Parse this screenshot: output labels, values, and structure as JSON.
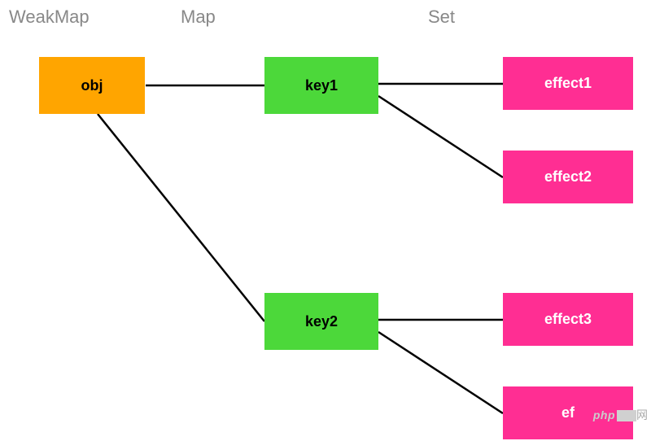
{
  "headers": {
    "weakmap": "WeakMap",
    "map": "Map",
    "set": "Set"
  },
  "nodes": {
    "obj": "obj",
    "key1": "key1",
    "key2": "key2",
    "effect1": "effect1",
    "effect2": "effect2",
    "effect3": "effect3",
    "effect4": "ef"
  },
  "watermark": {
    "brand": "php",
    "suffix": "网"
  },
  "chart_data": {
    "type": "diagram",
    "title": "Reactive effect tracking structure",
    "structure": {
      "WeakMap": {
        "obj": {
          "type": "Map",
          "entries": {
            "key1": {
              "type": "Set",
              "items": [
                "effect1",
                "effect2"
              ]
            },
            "key2": {
              "type": "Set",
              "items": [
                "effect3",
                "effect4"
              ]
            }
          }
        }
      }
    },
    "columns": [
      {
        "label": "WeakMap",
        "nodes": [
          "obj"
        ]
      },
      {
        "label": "Map",
        "nodes": [
          "key1",
          "key2"
        ]
      },
      {
        "label": "Set",
        "nodes": [
          "effect1",
          "effect2",
          "effect3",
          "effect4"
        ]
      }
    ],
    "edges": [
      [
        "obj",
        "key1"
      ],
      [
        "obj",
        "key2"
      ],
      [
        "key1",
        "effect1"
      ],
      [
        "key1",
        "effect2"
      ],
      [
        "key2",
        "effect3"
      ],
      [
        "key2",
        "effect4"
      ]
    ]
  }
}
